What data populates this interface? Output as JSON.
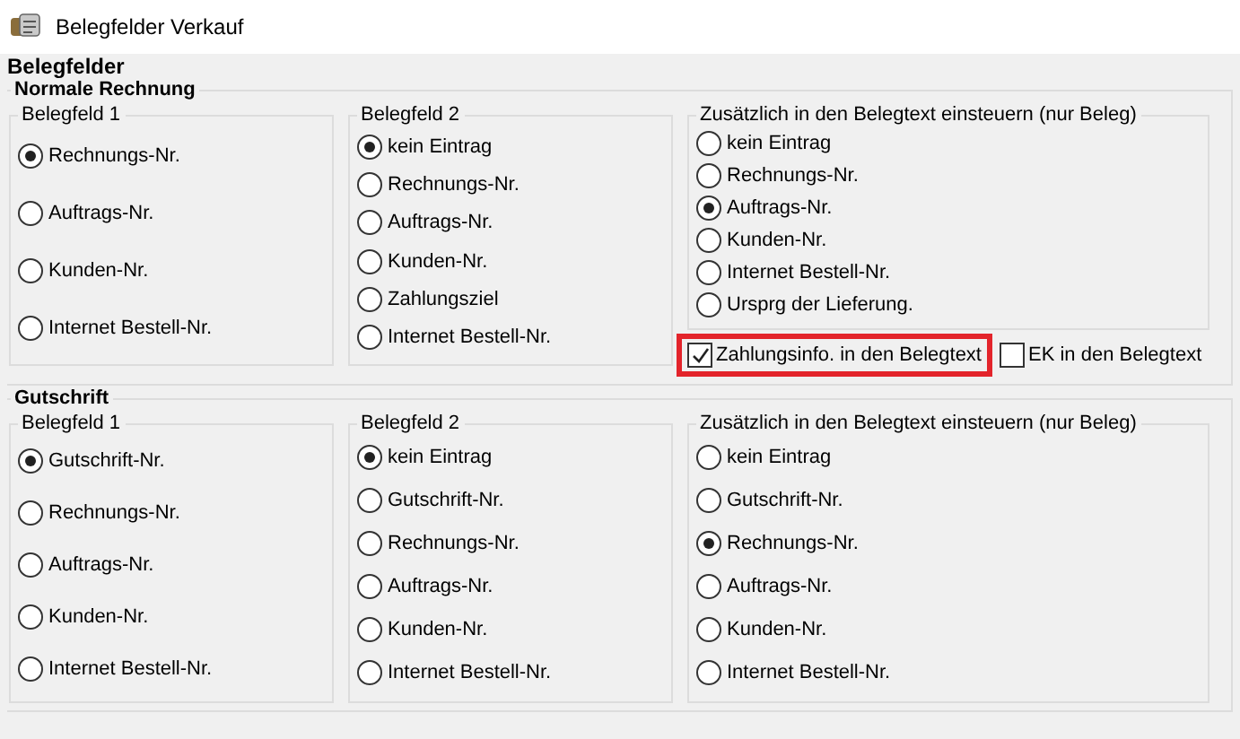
{
  "window": {
    "title": "Belegfelder Verkauf"
  },
  "heading": "Belegfelder",
  "sections": [
    {
      "title": "Normale Rechnung",
      "groups": [
        {
          "title": "Belegfeld 1",
          "options": [
            {
              "label": "Rechnungs-Nr.",
              "selected": true
            },
            {
              "label": "Auftrags-Nr.",
              "selected": false
            },
            {
              "label": "Kunden-Nr.",
              "selected": false
            },
            {
              "label": "Internet Bestell-Nr.",
              "selected": false
            }
          ]
        },
        {
          "title": "Belegfeld 2",
          "options": [
            {
              "label": "kein Eintrag",
              "selected": true
            },
            {
              "label": "Rechnungs-Nr.",
              "selected": false
            },
            {
              "label": "Auftrags-Nr.",
              "selected": false
            },
            {
              "label": "Kunden-Nr.",
              "selected": false
            },
            {
              "label": "Zahlungsziel",
              "selected": false
            },
            {
              "label": "Internet Bestell-Nr.",
              "selected": false
            }
          ]
        },
        {
          "title": "Zusätzlich in den Belegtext einsteuern (nur Beleg)",
          "options": [
            {
              "label": "kein Eintrag",
              "selected": false
            },
            {
              "label": "Rechnungs-Nr.",
              "selected": false
            },
            {
              "label": "Auftrags-Nr.",
              "selected": true
            },
            {
              "label": "Kunden-Nr.",
              "selected": false
            },
            {
              "label": "Internet Bestell-Nr.",
              "selected": false
            },
            {
              "label": "Ursprg der Lieferung.",
              "selected": false
            }
          ]
        }
      ],
      "checkboxes": [
        {
          "label": "Zahlungsinfo. in den Belegtext",
          "checked": true,
          "highlighted": true
        },
        {
          "label": "EK in den Belegtext",
          "checked": false,
          "highlighted": false
        }
      ]
    },
    {
      "title": "Gutschrift",
      "groups": [
        {
          "title": "Belegfeld 1",
          "options": [
            {
              "label": "Gutschrift-Nr.",
              "selected": true
            },
            {
              "label": "Rechnungs-Nr.",
              "selected": false
            },
            {
              "label": "Auftrags-Nr.",
              "selected": false
            },
            {
              "label": "Kunden-Nr.",
              "selected": false
            },
            {
              "label": "Internet Bestell-Nr.",
              "selected": false
            }
          ]
        },
        {
          "title": "Belegfeld 2",
          "options": [
            {
              "label": "kein Eintrag",
              "selected": true
            },
            {
              "label": "Gutschrift-Nr.",
              "selected": false
            },
            {
              "label": "Rechnungs-Nr.",
              "selected": false
            },
            {
              "label": "Auftrags-Nr.",
              "selected": false
            },
            {
              "label": "Kunden-Nr.",
              "selected": false
            },
            {
              "label": "Internet Bestell-Nr.",
              "selected": false
            }
          ]
        },
        {
          "title": "Zusätzlich in den Belegtext einsteuern (nur Beleg)",
          "options": [
            {
              "label": "kein Eintrag",
              "selected": false
            },
            {
              "label": "Gutschrift-Nr.",
              "selected": false
            },
            {
              "label": "Rechnungs-Nr.",
              "selected": true
            },
            {
              "label": "Auftrags-Nr.",
              "selected": false
            },
            {
              "label": "Kunden-Nr.",
              "selected": false
            },
            {
              "label": "Internet Bestell-Nr.",
              "selected": false
            }
          ]
        }
      ]
    }
  ]
}
